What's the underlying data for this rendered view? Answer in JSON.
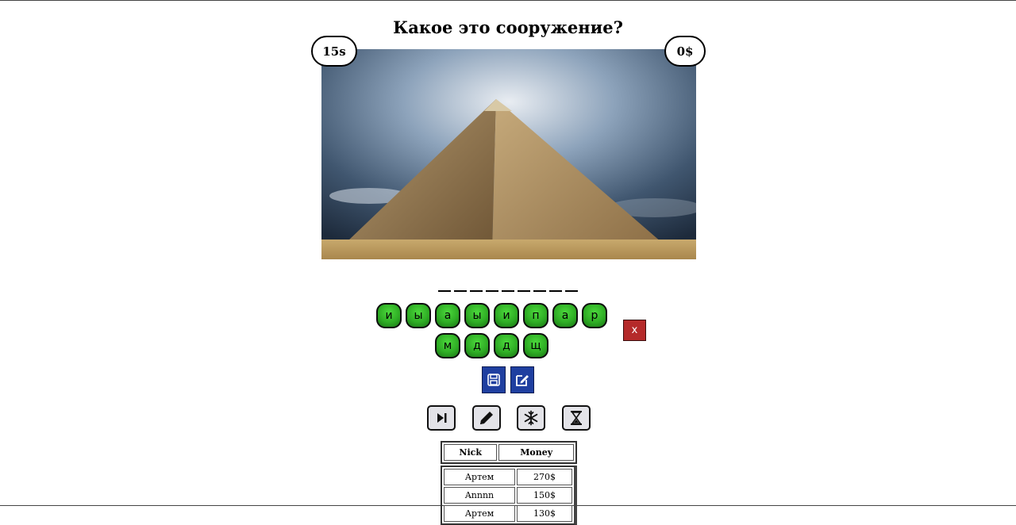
{
  "question": "Какое это сооружение?",
  "timer": "15s",
  "money": "0$",
  "answer_mask": [
    "_",
    "_",
    "_",
    "_",
    "_",
    "_",
    "_",
    "_",
    "_"
  ],
  "letters": [
    "и",
    "ы",
    "а",
    "ы",
    "и",
    "п",
    "а",
    "р",
    "м",
    "д",
    "д",
    "щ"
  ],
  "clear_label": "x",
  "icons": {
    "save": "save-icon",
    "edit": "edit-icon",
    "skip": "skip-icon",
    "pencil": "pencil-icon",
    "freeze": "snowflake-icon",
    "time": "hourglass-icon"
  },
  "leaderboard": {
    "headers": [
      "Nick",
      "Money"
    ],
    "rows": [
      {
        "nick": "Артем",
        "money": "270$"
      },
      {
        "nick": "Annnn",
        "money": "150$"
      },
      {
        "nick": "Артем",
        "money": "130$"
      }
    ]
  },
  "colors": {
    "letter_green": "#2fae25",
    "clear_red": "#b52a2a",
    "save_blue": "#1f3fa0"
  }
}
